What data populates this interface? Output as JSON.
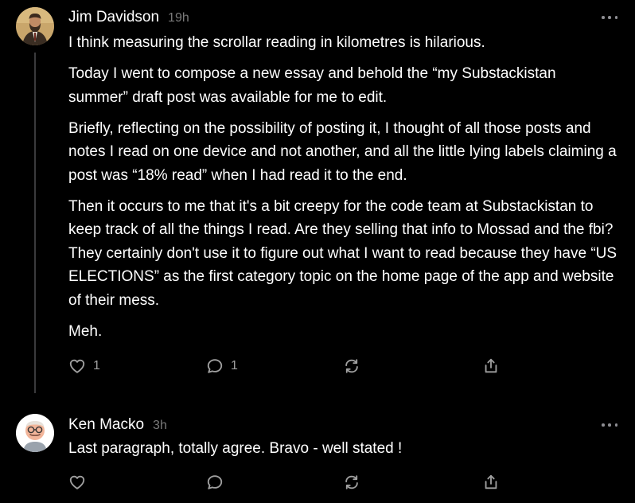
{
  "comments": [
    {
      "author": "Jim Davidson",
      "time": "19h",
      "paragraphs": [
        "I think measuring the scrollar reading in kilometres is hilarious.",
        "Today I went to compose a new essay and behold the “my Substackistan summer” draft post was available for me to edit.",
        "Briefly, reflecting on the possibility of posting it, I thought of all those posts and notes I read on one device and not another, and all the little lying labels claiming a post was “18% read” when I had read it to the end.",
        "Then it occurs to me that it's a bit creepy for the code team at Substackistan to keep track of all the things I read. Are they selling that info to Mossad and the fbi? They certainly don't use it to figure out what I want to read because they have “US ELECTIONS” as the first category topic on the home page of the app and website of their mess.",
        "Meh."
      ],
      "like_count": "1",
      "reply_count": "1",
      "icons": {
        "more": "more-horizontal-icon",
        "like": "heart-icon",
        "reply": "comment-bubble-icon",
        "restack": "restack-icon",
        "share": "share-icon"
      }
    },
    {
      "author": "Ken Macko",
      "time": "3h",
      "paragraphs": [
        "Last paragraph, totally agree. Bravo - well stated !"
      ],
      "like_count": "",
      "reply_count": "",
      "icons": {
        "more": "more-horizontal-icon",
        "like": "heart-icon",
        "reply": "comment-bubble-icon",
        "restack": "restack-icon",
        "share": "share-icon"
      }
    }
  ],
  "colors": {
    "background": "#000000",
    "text": "#ffffff",
    "muted": "#7a7a7a",
    "icon": "#a0a0a0",
    "thread_line": "#3a3a3c"
  }
}
